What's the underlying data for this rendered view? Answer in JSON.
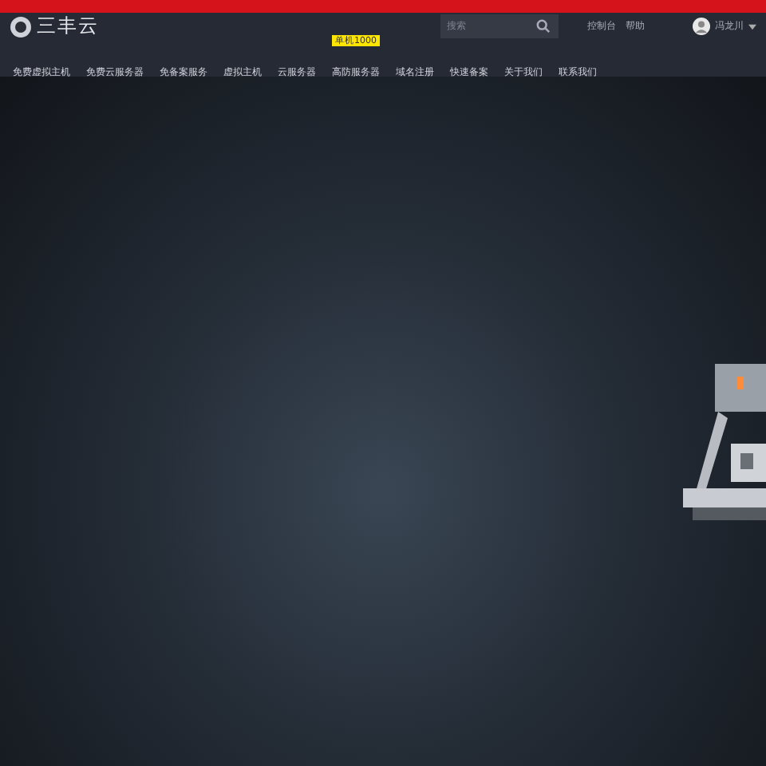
{
  "header": {
    "logo_text": "三丰云",
    "search": {
      "placeholder": "搜索"
    },
    "links": [
      "控制台",
      "帮助"
    ],
    "user": {
      "name": "冯龙川"
    }
  },
  "nav": {
    "items": [
      {
        "label": "免费虚拟主机"
      },
      {
        "label": "免费云服务器"
      },
      {
        "label": "免备案服务"
      },
      {
        "label": "虚拟主机"
      },
      {
        "label": "云服务器"
      },
      {
        "label": "高防服务器",
        "badge": "单机1000"
      },
      {
        "label": "域名注册"
      },
      {
        "label": "快速备案"
      },
      {
        "label": "关于我们"
      },
      {
        "label": "联系我们"
      }
    ]
  }
}
